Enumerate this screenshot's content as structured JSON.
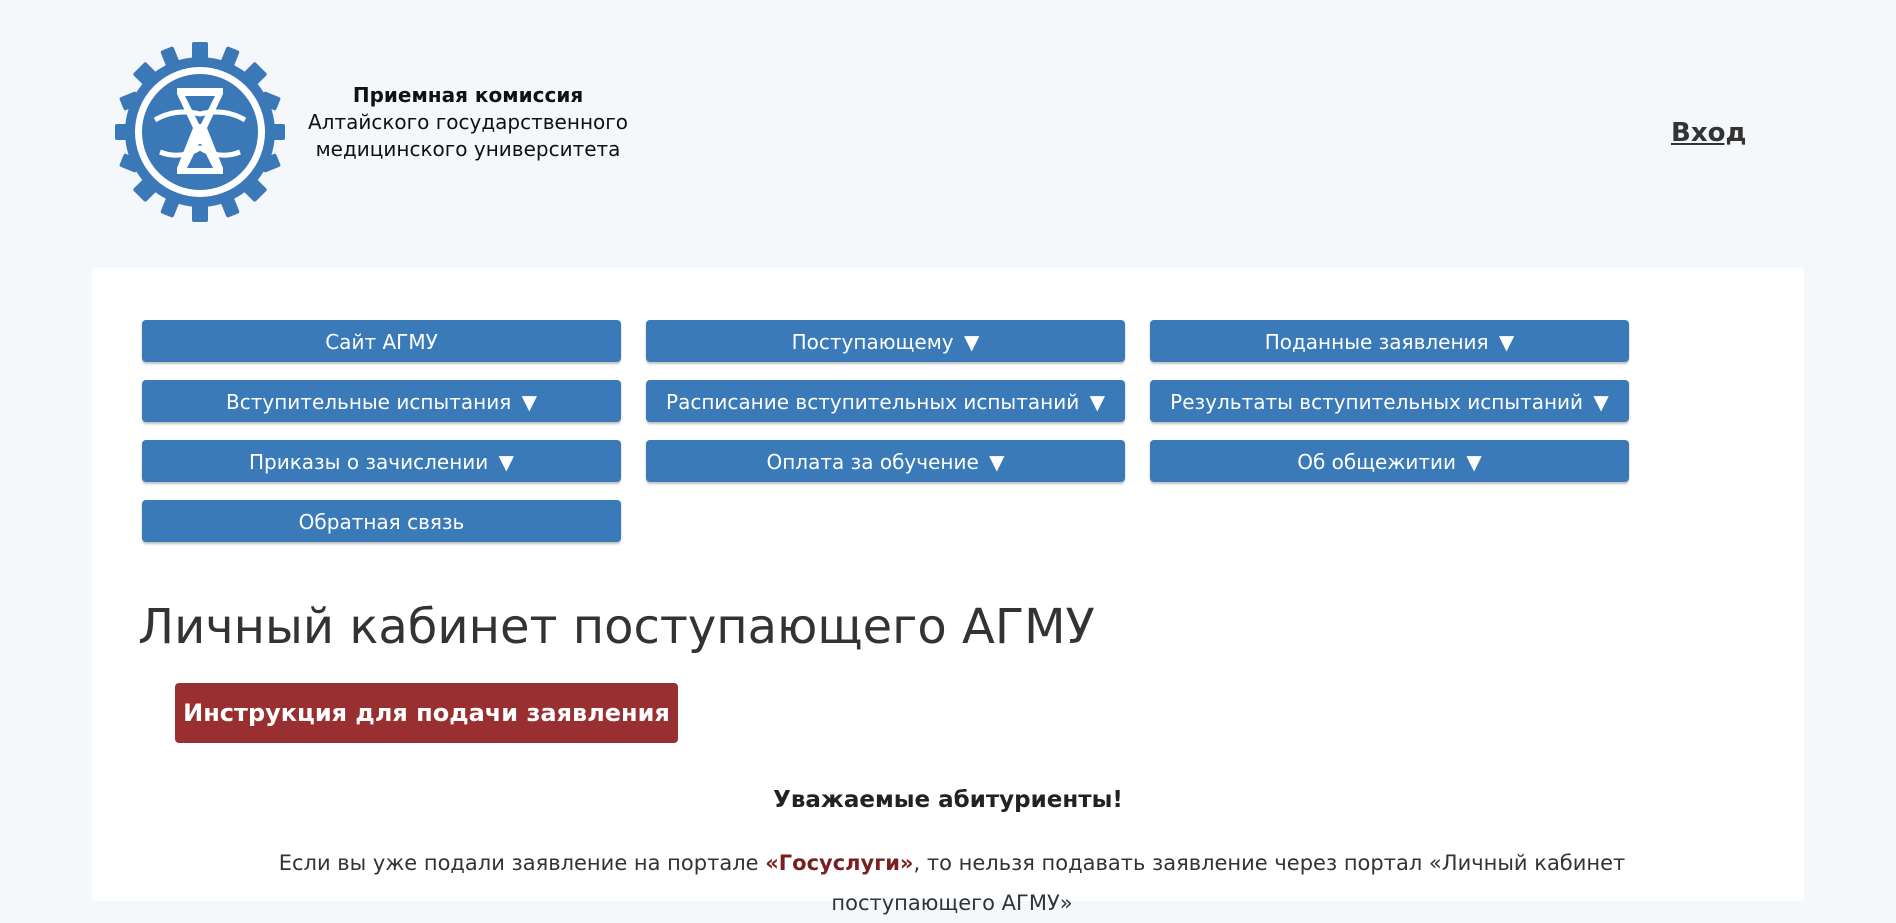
{
  "header": {
    "brand_line1": "Приемная комиссия",
    "brand_line2": "Алтайского государственного",
    "brand_line3": "медицинского университета",
    "login_label": "Вход",
    "logo_icon": "agmu-logo-icon",
    "logo_color": "#3a78b8"
  },
  "menu": {
    "items": [
      {
        "label": "Сайт АГМУ",
        "arrow": ""
      },
      {
        "label": "Поступающему",
        "arrow": "▼"
      },
      {
        "label": "Поданные заявления",
        "arrow": "▼"
      },
      {
        "label": "Вступительные испытания",
        "arrow": "▼"
      },
      {
        "label": "Расписание вступительных испытаний",
        "arrow": "▼"
      },
      {
        "label": "Результаты вступительных испытаний",
        "arrow": "▼"
      },
      {
        "label": "Приказы о зачислении",
        "arrow": "▼"
      },
      {
        "label": "Оплата за обучение",
        "arrow": "▼"
      },
      {
        "label": "Об общежитии",
        "arrow": "▼"
      },
      {
        "label": "Обратная связь",
        "arrow": ""
      }
    ],
    "button_color": "#3a7ab8"
  },
  "main": {
    "title": "Личный кабинет поступающего АГМУ",
    "instruction_button": "Инструкция для подачи заявления",
    "instruction_color": "#9a2f32",
    "greeting": "Уважаемые абитуриенты!",
    "notice_part1": "Если вы уже подали заявление на портале ",
    "notice_gosuslugi": "«Госуслуги»",
    "notice_part2": ", то нельзя подавать заявление через портал «Личный кабинет поступающего АГМУ»"
  }
}
